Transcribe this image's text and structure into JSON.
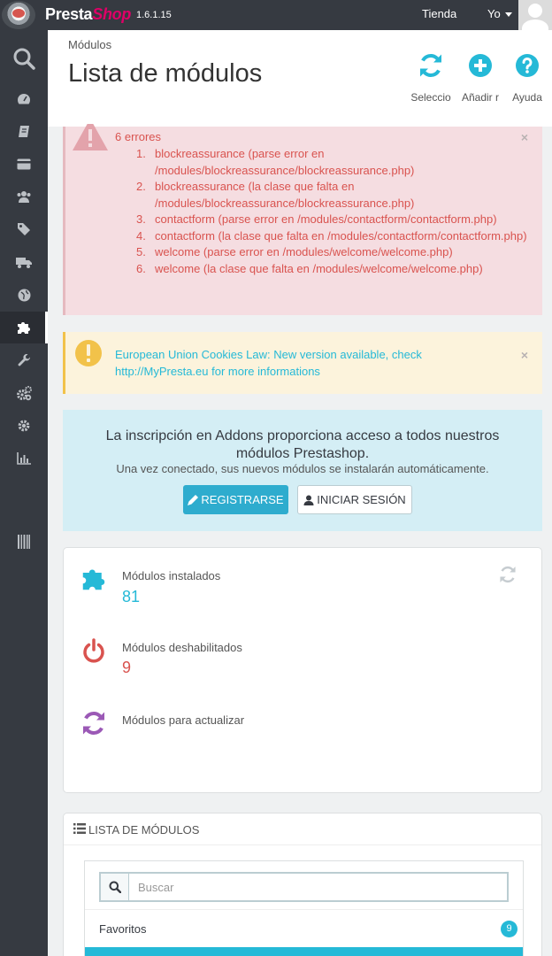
{
  "topbar": {
    "brand_main": "Presta",
    "brand_accent": "Shop",
    "version": "1.6.1.15",
    "shop_link": "Tienda",
    "user_link": "Yo"
  },
  "sidebar": {
    "items": [
      {
        "icon": "search-icon"
      },
      {
        "icon": "dashboard-icon"
      },
      {
        "icon": "orders-icon"
      },
      {
        "icon": "credit-card-icon"
      },
      {
        "icon": "customers-icon"
      },
      {
        "icon": "tags-icon"
      },
      {
        "icon": "truck-icon"
      },
      {
        "icon": "globe-icon"
      },
      {
        "icon": "puzzle-icon",
        "active": true
      },
      {
        "icon": "wrench-icon"
      },
      {
        "icon": "cogs-icon"
      },
      {
        "icon": "gear-icon"
      },
      {
        "icon": "stats-icon"
      },
      {
        "icon": "barcode-icon"
      }
    ]
  },
  "header": {
    "breadcrumb": "Módulos",
    "title": "Lista de módulos",
    "toolbar": [
      {
        "label": "Seleccio",
        "icon": "refresh-icon"
      },
      {
        "label": "Añadir r",
        "icon": "plus-circle-icon"
      },
      {
        "label": "Ayuda",
        "icon": "help-icon"
      }
    ]
  },
  "errors": {
    "count_text": "6 errores",
    "items": [
      "blockreassurance (parse error en /modules/blockreassurance/blockreassurance.php)",
      "blockreassurance (la clase que falta en /modules/blockreassurance/blockreassurance.php)",
      "contactform (parse error en /modules/contactform/contactform.php)",
      "contactform (la clase que falta en /modules/contactform/contactform.php)",
      "welcome (parse error en /modules/welcome/welcome.php)",
      "welcome (la clase que falta en /modules/welcome/welcome.php)"
    ],
    "close": "×"
  },
  "warning": {
    "text": "European Union Cookies Law: New version available, check http://MyPresta.eu for more informations",
    "close": "×"
  },
  "addons": {
    "title": "La inscripción en Addons proporciona acceso a todos nuestros módulos Prestashop.",
    "subtitle": "Una vez conectado, sus nuevos módulos se instalarán automáticamente.",
    "register_label": "REGISTRARSE",
    "login_label": "INICIAR SESIÓN"
  },
  "stats": {
    "installed_label": "Módulos instalados",
    "installed_value": "81",
    "disabled_label": "Módulos deshabilitados",
    "disabled_value": "9",
    "update_label": "Módulos para actualizar"
  },
  "module_list": {
    "heading": "Lista de módulos",
    "search_placeholder": "Buscar",
    "favorites_label": "Favoritos",
    "favorites_count": "9"
  },
  "colors": {
    "dark": "#363a41",
    "accent": "#25b9d7",
    "danger": "#d9534f",
    "purple": "#9b59b6"
  }
}
